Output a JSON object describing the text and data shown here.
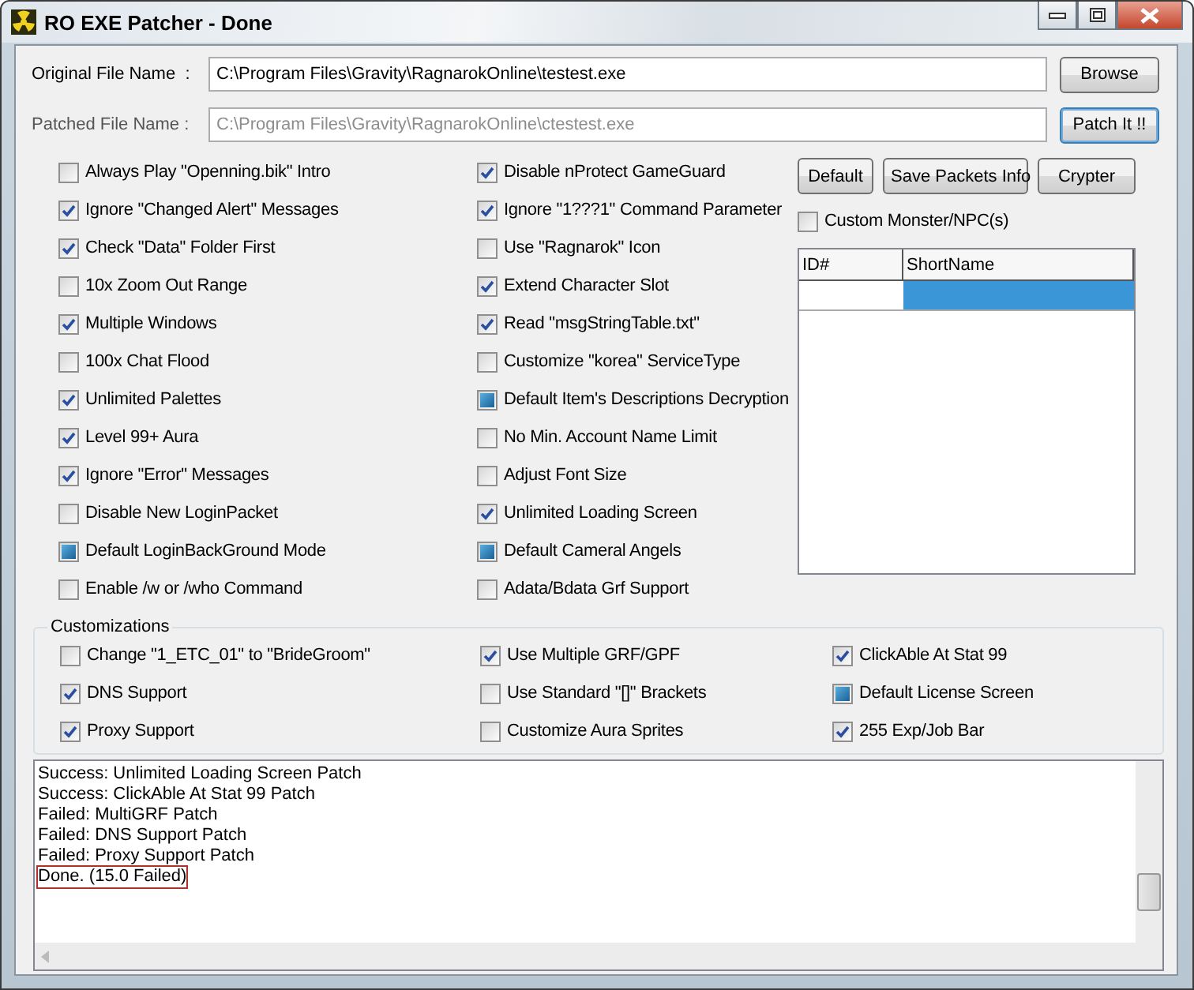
{
  "window": {
    "title": "RO EXE Patcher - Done"
  },
  "files": [
    {
      "label": "Original File Name  :",
      "value": "C:\\Program Files\\Gravity\\RagnarokOnline\\testest.exe",
      "disabled": false,
      "button": "Browse",
      "focused": false
    },
    {
      "label": "Patched File Name :",
      "value": "C:\\Program Files\\Gravity\\RagnarokOnline\\ctestest.exe",
      "disabled": true,
      "button": "Patch It !!",
      "focused": true
    }
  ],
  "options": [
    [
      {
        "label": "Always Play \"Openning.bik\" Intro",
        "kind": "check",
        "checked": false
      },
      {
        "label": "Ignore \"Changed Alert\" Messages",
        "kind": "check",
        "checked": true
      },
      {
        "label": "Check \"Data\" Folder First",
        "kind": "check",
        "checked": true
      },
      {
        "label": "10x Zoom Out Range",
        "kind": "check",
        "checked": false
      },
      {
        "label": "Multiple Windows",
        "kind": "check",
        "checked": true
      },
      {
        "label": "100x Chat Flood",
        "kind": "check",
        "checked": false
      },
      {
        "label": "Unlimited Palettes",
        "kind": "check",
        "checked": true
      },
      {
        "label": "Level 99+ Aura",
        "kind": "check",
        "checked": true
      },
      {
        "label": "Ignore \"Error\" Messages",
        "kind": "check",
        "checked": true
      },
      {
        "label": "Disable New LoginPacket",
        "kind": "check",
        "checked": false
      },
      {
        "label": "Default LoginBackGround Mode",
        "kind": "mixed",
        "checked": false
      },
      {
        "label": "Enable /w or /who  Command",
        "kind": "check",
        "checked": false
      }
    ],
    [
      {
        "label": "Disable nProtect GameGuard",
        "kind": "check",
        "checked": true
      },
      {
        "label": "Ignore \"1???1\" Command Parameter",
        "kind": "check",
        "checked": true
      },
      {
        "label": "Use \"Ragnarok\" Icon",
        "kind": "check",
        "checked": false
      },
      {
        "label": "Extend Character Slot",
        "kind": "check",
        "checked": true
      },
      {
        "label": "Read \"msgStringTable.txt\"",
        "kind": "check",
        "checked": true
      },
      {
        "label": "Customize \"korea\" ServiceType",
        "kind": "check",
        "checked": false
      },
      {
        "label": "Default Item's Descriptions Decryption",
        "kind": "mixed",
        "checked": false
      },
      {
        "label": "No Min. Account Name Limit",
        "kind": "check",
        "checked": false
      },
      {
        "label": "Adjust Font Size",
        "kind": "check",
        "checked": false
      },
      {
        "label": "Unlimited Loading Screen",
        "kind": "check",
        "checked": true
      },
      {
        "label": "Default Cameral Angels",
        "kind": "mixed",
        "checked": false
      },
      {
        "label": "Adata/Bdata Grf Support",
        "kind": "check",
        "checked": false
      }
    ]
  ],
  "buttons": [
    "Default",
    "Save Packets Info",
    "Crypter"
  ],
  "custom_npc": {
    "label": "Custom Monster/NPC(s)",
    "checked": false
  },
  "npc_table": {
    "columns": [
      "ID#",
      "ShortName"
    ],
    "rows": [
      {
        "selected": true
      }
    ]
  },
  "customizations": {
    "title": "Customizations",
    "columns": [
      [
        {
          "label": "Change \"1_ETC_01\" to \"BrideGroom\"",
          "kind": "check",
          "checked": false
        },
        {
          "label": "DNS Support",
          "kind": "check",
          "checked": true
        },
        {
          "label": "Proxy Support",
          "kind": "check",
          "checked": true
        }
      ],
      [
        {
          "label": "Use Multiple GRF/GPF",
          "kind": "check",
          "checked": true
        },
        {
          "label": "Use Standard \"[]\" Brackets",
          "kind": "check",
          "checked": false
        },
        {
          "label": "Customize Aura Sprites",
          "kind": "check",
          "checked": false
        }
      ],
      [
        {
          "label": "ClickAble At Stat 99",
          "kind": "check",
          "checked": true
        },
        {
          "label": "Default License Screen",
          "kind": "mixed",
          "checked": false
        },
        {
          "label": "255 Exp/Job Bar",
          "kind": "check",
          "checked": true
        }
      ]
    ]
  },
  "log": {
    "lines": [
      {
        "text": "Success: Unlimited Loading Screen Patch",
        "highlighted": false
      },
      {
        "text": "Success: ClickAble At Stat 99 Patch",
        "highlighted": false
      },
      {
        "text": "Failed: MultiGRF Patch",
        "highlighted": false
      },
      {
        "text": "Failed: DNS Support Patch",
        "highlighted": false
      },
      {
        "text": "Failed: Proxy Support Patch",
        "highlighted": false
      },
      {
        "text": "Done. (15.0 Failed)",
        "highlighted": true
      }
    ]
  }
}
